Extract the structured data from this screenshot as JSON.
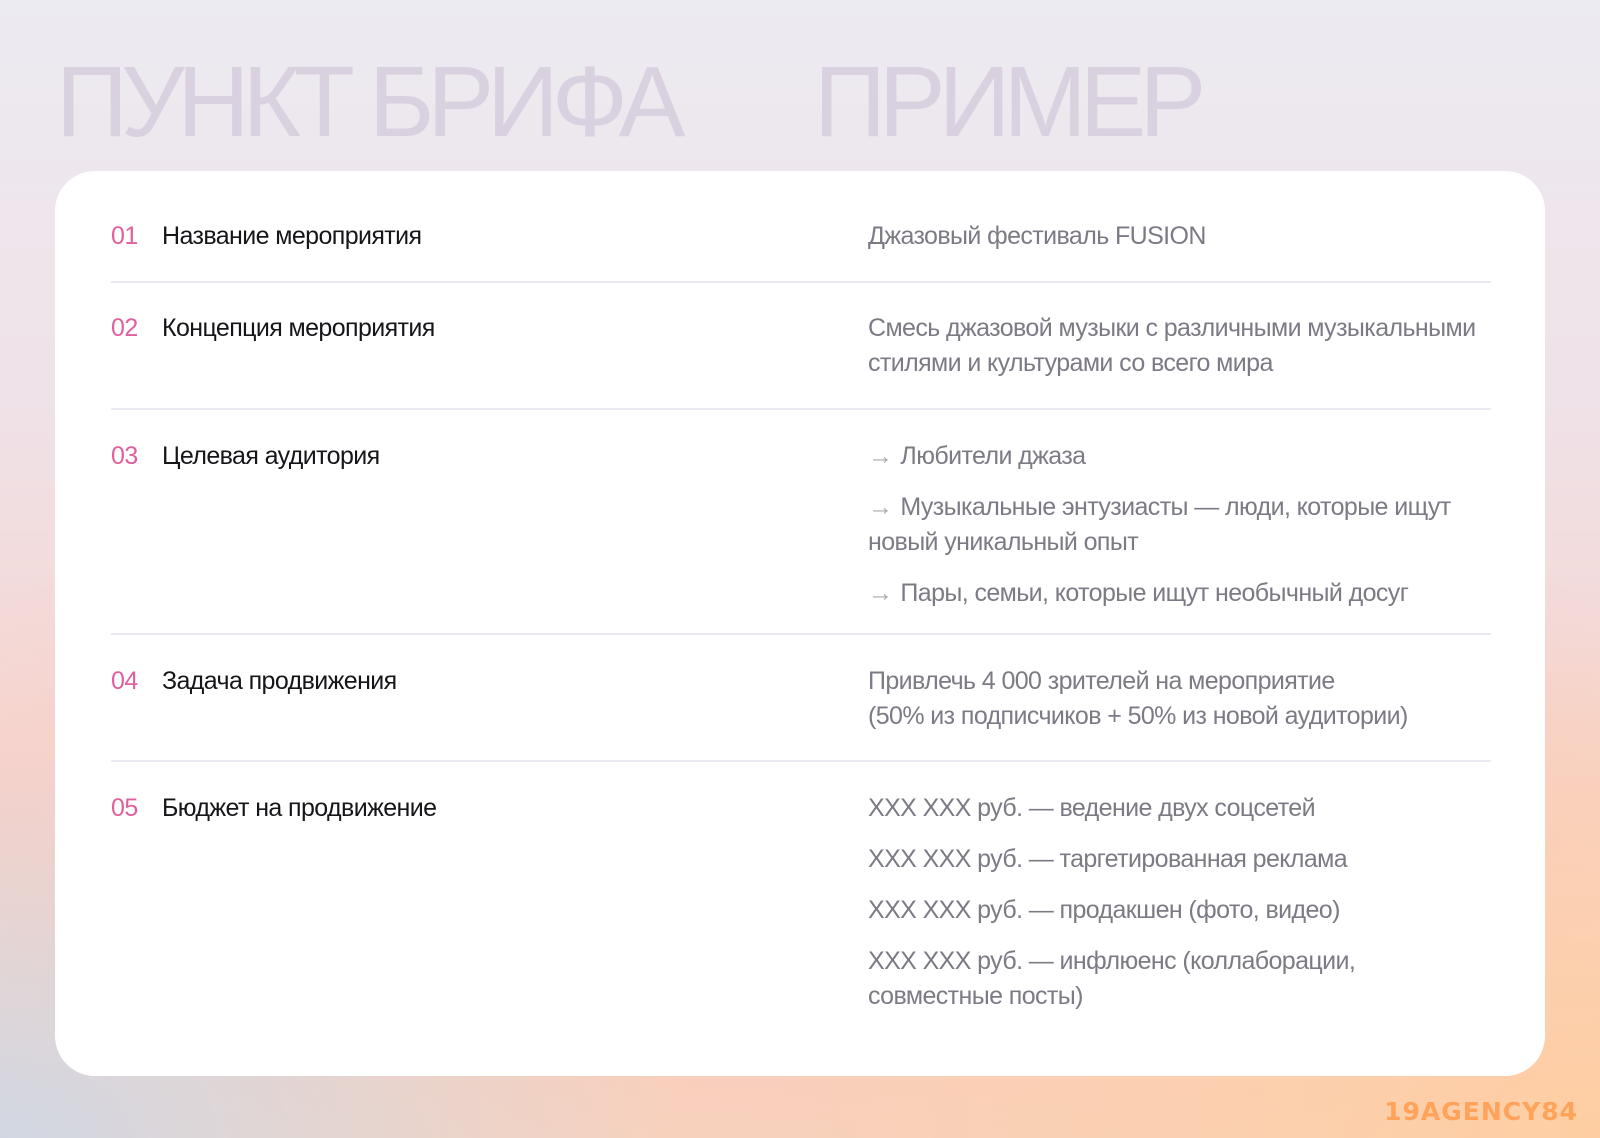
{
  "headings": {
    "left": "ПУНКТ БРИФА",
    "right": "ПРИМЕР"
  },
  "rows": [
    {
      "num": "01",
      "label": "Название мероприятия",
      "value": [
        "Джазовый фестиваль FUSION"
      ]
    },
    {
      "num": "02",
      "label": "Концепция мероприятия",
      "value": [
        "Смесь джазовой музыки с различными музыкальными стилями и культурами со всего мира"
      ]
    },
    {
      "num": "03",
      "label": "Целевая аудитория",
      "value": [
        "Любители джаза",
        "Музыкальные энтузиасты — люди, которые ищут новый уникальный опыт",
        "Пары, семьи, которые ищут необычный досуг"
      ]
    },
    {
      "num": "04",
      "label": "Задача продвижения",
      "value": [
        "Привлечь 4 000 зрителей на мероприятие",
        "(50% из подписчиков + 50% из новой аудитории)"
      ]
    },
    {
      "num": "05",
      "label": "Бюджет на продвижение",
      "value": [
        "XXX XXX руб. — ведение двух соцсетей",
        "XXX XXX руб. — таргетированная реклама",
        "XXX XXX руб. — продакшен (фото, видео)",
        "XXX XXX руб. — инфлюенс (коллаборации, совместные посты)"
      ]
    }
  ],
  "bullet_icon": "arrow-right-icon",
  "logo": "19AGENCY84",
  "colors": {
    "accent_number": "#e0609d",
    "logo": "#ffa35a",
    "heading_ghost": "#d9d0e0"
  }
}
